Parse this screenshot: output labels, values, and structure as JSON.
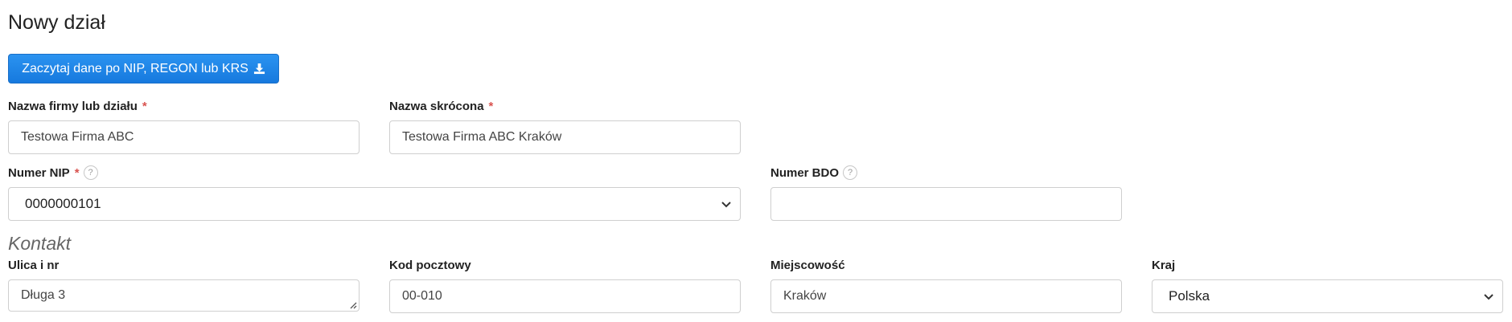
{
  "page": {
    "title": "Nowy dział"
  },
  "fetch_button": {
    "label": "Zaczytaj dane po NIP, REGON lub KRS",
    "icon": "download-icon"
  },
  "fields": {
    "company_name": {
      "label": "Nazwa firmy lub działu",
      "required_mark": "*",
      "value": "Testowa Firma ABC"
    },
    "short_name": {
      "label": "Nazwa skrócona",
      "required_mark": "*",
      "value": "Testowa Firma ABC Kraków"
    },
    "nip": {
      "label": "Numer NIP",
      "required_mark": "*",
      "help": "?",
      "value": "0000000101"
    },
    "bdo": {
      "label": "Numer BDO",
      "help": "?",
      "value": ""
    }
  },
  "contact": {
    "heading": "Kontakt",
    "street": {
      "label": "Ulica i nr",
      "value": "Długa 3"
    },
    "postal_code": {
      "label": "Kod pocztowy",
      "value": "00-010"
    },
    "city": {
      "label": "Miejscowość",
      "value": "Kraków"
    },
    "country": {
      "label": "Kraj",
      "value": "Polska"
    }
  },
  "colors": {
    "primary": "#1679de",
    "required": "#d9534f",
    "border": "#cfcfcf"
  }
}
